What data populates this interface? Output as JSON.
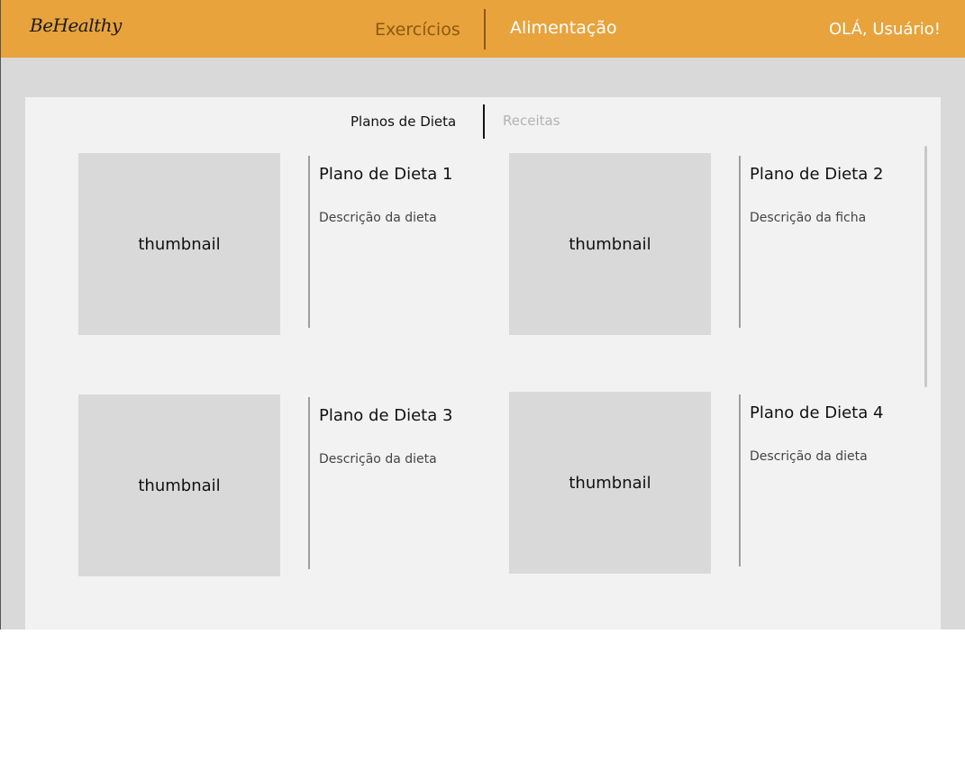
{
  "header": {
    "logo": "BeHealthy",
    "nav": [
      {
        "label": "Exercícios",
        "color": "#8a5a10"
      },
      {
        "label": "Alimentação",
        "color": "#ffffff"
      }
    ],
    "greeting": "OLÁ, Usuário!",
    "background": "#e8a33c"
  },
  "tabs": [
    {
      "label": "Planos de Dieta",
      "active": true
    },
    {
      "label": "Receitas",
      "active": false
    }
  ],
  "cards": [
    {
      "thumbnail": "thumbnail",
      "title": "Plano de Dieta 1",
      "description": "Descrição da dieta"
    },
    {
      "thumbnail": "thumbnail",
      "title": "Plano de Dieta 2",
      "description": "Descrição da ficha"
    },
    {
      "thumbnail": "thumbnail",
      "title": "Plano de Dieta 3",
      "description": "Descrição da dieta"
    },
    {
      "thumbnail": "thumbnail",
      "title": "Plano de Dieta 4",
      "description": "Descrição da dieta"
    }
  ]
}
